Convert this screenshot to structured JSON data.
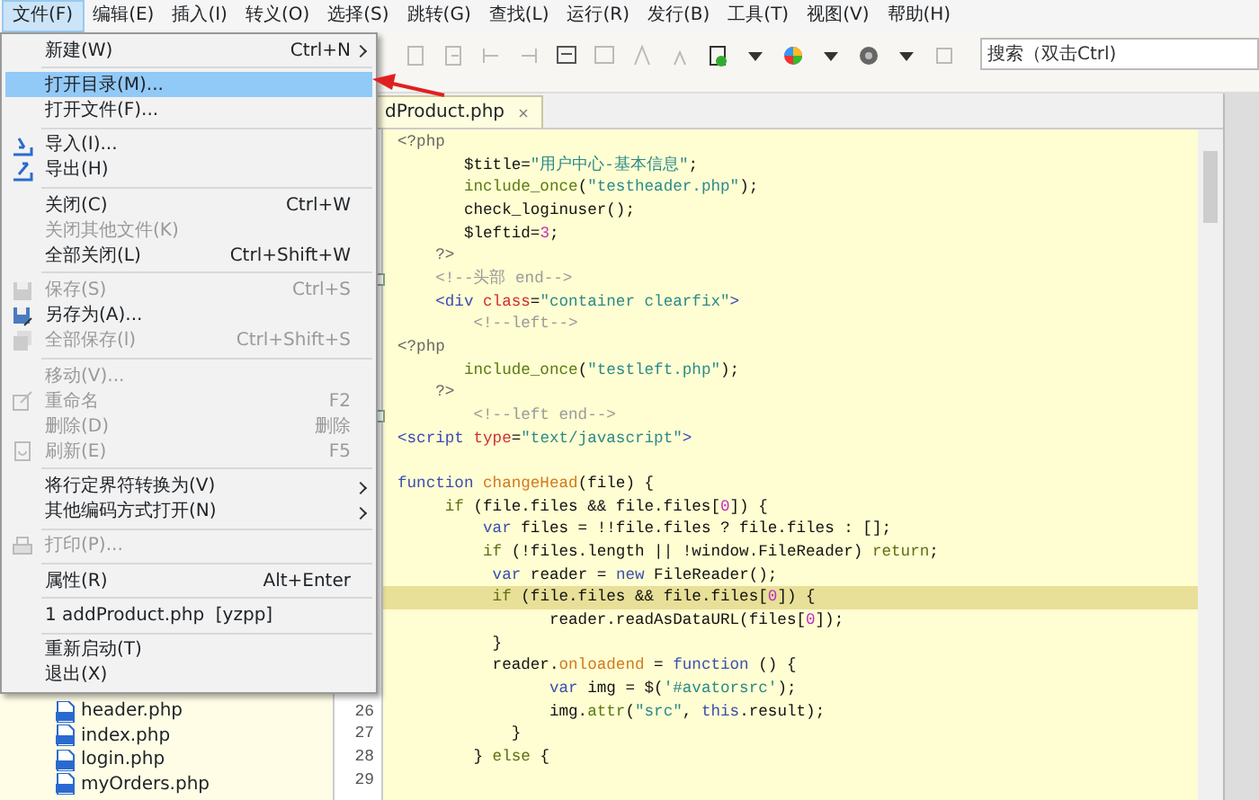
{
  "menubar": [
    {
      "label": "文件(F)",
      "selected": true
    },
    {
      "label": "编辑(E)",
      "selected": false
    },
    {
      "label": "插入(I)",
      "selected": false
    },
    {
      "label": "转义(O)",
      "selected": false
    },
    {
      "label": "选择(S)",
      "selected": false
    },
    {
      "label": "跳转(G)",
      "selected": false
    },
    {
      "label": "查找(L)",
      "selected": false
    },
    {
      "label": "运行(R)",
      "selected": false
    },
    {
      "label": "发行(B)",
      "selected": false
    },
    {
      "label": "工具(T)",
      "selected": false
    },
    {
      "label": "视图(V)",
      "selected": false
    },
    {
      "label": "帮助(H)",
      "selected": false
    }
  ],
  "search": {
    "placeholder": "搜索（双击Ctrl)"
  },
  "editor_tab": {
    "label": "dProduct.php"
  },
  "code_lines": [
    {
      "tokens": [
        {
          "kind": "php",
          "text": "<?php"
        }
      ]
    },
    {
      "tokens": [
        {
          "kind": "plain",
          "text": "       $title="
        },
        {
          "kind": "str",
          "text": "\"用户中心-基本信息\""
        },
        {
          "kind": "plain",
          "text": ";"
        }
      ]
    },
    {
      "tokens": [
        {
          "kind": "call",
          "text": "       include_once"
        },
        {
          "kind": "plain",
          "text": "("
        },
        {
          "kind": "str",
          "text": "\"testheader.php\""
        },
        {
          "kind": "plain",
          "text": ");"
        }
      ]
    },
    {
      "tokens": [
        {
          "kind": "plain",
          "text": "       check_loginuser();"
        }
      ]
    },
    {
      "tokens": [
        {
          "kind": "plain",
          "text": "       $leftid="
        },
        {
          "kind": "num",
          "text": "3"
        },
        {
          "kind": "plain",
          "text": ";"
        }
      ]
    },
    {
      "tokens": [
        {
          "kind": "php",
          "text": "    ?>"
        }
      ]
    },
    {
      "fold": true,
      "tokens": [
        {
          "kind": "cmt",
          "text": "    <!--头部 end-->"
        }
      ]
    },
    {
      "tokens": [
        {
          "kind": "tag",
          "text": "    <div"
        },
        {
          "kind": "attr",
          "text": " class"
        },
        {
          "kind": "plain",
          "text": "="
        },
        {
          "kind": "str",
          "text": "\"container clearfix\""
        },
        {
          "kind": "tag",
          "text": ">"
        }
      ]
    },
    {
      "tokens": [
        {
          "kind": "cmt",
          "text": "        <!--left-->"
        }
      ]
    },
    {
      "tokens": [
        {
          "kind": "php",
          "text": "<?php"
        }
      ]
    },
    {
      "tokens": [
        {
          "kind": "call",
          "text": "       include_once"
        },
        {
          "kind": "plain",
          "text": "("
        },
        {
          "kind": "str",
          "text": "\"testleft.php\""
        },
        {
          "kind": "plain",
          "text": ");"
        }
      ]
    },
    {
      "tokens": [
        {
          "kind": "php",
          "text": "    ?>"
        }
      ]
    },
    {
      "fold": true,
      "tokens": [
        {
          "kind": "cmt",
          "text": "        <!--left end-->"
        }
      ]
    },
    {
      "tokens": [
        {
          "kind": "tag",
          "text": "<script"
        },
        {
          "kind": "attr",
          "text": " type"
        },
        {
          "kind": "plain",
          "text": "="
        },
        {
          "kind": "str",
          "text": "\"text/javascript\""
        },
        {
          "kind": "tag",
          "text": ">"
        }
      ]
    },
    {
      "gap_before": true,
      "tokens": [
        {
          "kind": "kw",
          "text": "function"
        },
        {
          "kind": "fn",
          "text": " changeHead"
        },
        {
          "kind": "plain",
          "text": "(file) {"
        }
      ]
    },
    {
      "tokens": [
        {
          "kind": "ctrl",
          "text": "     if"
        },
        {
          "kind": "plain",
          "text": " (file.files && file.files["
        },
        {
          "kind": "num",
          "text": "0"
        },
        {
          "kind": "plain",
          "text": "]) {"
        }
      ]
    },
    {
      "tokens": [
        {
          "kind": "kw",
          "text": "         var"
        },
        {
          "kind": "plain",
          "text": " files = !!file.files ? file.files : [];"
        }
      ]
    },
    {
      "tokens": [
        {
          "kind": "ctrl",
          "text": "         if"
        },
        {
          "kind": "plain",
          "text": " (!files.length || !window.FileReader) "
        },
        {
          "kind": "ctrl",
          "text": "return"
        },
        {
          "kind": "plain",
          "text": ";"
        }
      ]
    },
    {
      "tokens": [
        {
          "kind": "kw",
          "text": "          var"
        },
        {
          "kind": "plain",
          "text": " reader = "
        },
        {
          "kind": "kw",
          "text": "new"
        },
        {
          "kind": "plain",
          "text": " FileReader();"
        }
      ]
    },
    {
      "current": true,
      "tokens": [
        {
          "kind": "ctrl",
          "text": "          if"
        },
        {
          "kind": "plain",
          "text": " (file.files && file.files["
        },
        {
          "kind": "num",
          "text": "0"
        },
        {
          "kind": "plain",
          "text": "]) {"
        }
      ]
    },
    {
      "tokens": [
        {
          "kind": "plain",
          "text": "                reader.readAsDataURL(files["
        },
        {
          "kind": "num",
          "text": "0"
        },
        {
          "kind": "plain",
          "text": "]);"
        }
      ]
    },
    {
      "tokens": [
        {
          "kind": "plain",
          "text": "          }"
        }
      ]
    },
    {
      "tokens": [
        {
          "kind": "plain",
          "text": "          reader."
        },
        {
          "kind": "fn",
          "text": "onloadend"
        },
        {
          "kind": "plain",
          "text": " = "
        },
        {
          "kind": "kw",
          "text": "function"
        },
        {
          "kind": "plain",
          "text": " () {"
        }
      ]
    },
    {
      "tokens": [
        {
          "kind": "kw",
          "text": "                var"
        },
        {
          "kind": "plain",
          "text": " img = $("
        },
        {
          "kind": "str",
          "text": "'#avatorsrc'"
        },
        {
          "kind": "plain",
          "text": ");"
        }
      ]
    },
    {
      "number": "26",
      "tokens": [
        {
          "kind": "plain",
          "text": "                img."
        },
        {
          "kind": "call",
          "text": "attr"
        },
        {
          "kind": "plain",
          "text": "("
        },
        {
          "kind": "str",
          "text": "\"src\""
        },
        {
          "kind": "plain",
          "text": ", "
        },
        {
          "kind": "kw",
          "text": "this"
        },
        {
          "kind": "plain",
          "text": ".result);"
        }
      ]
    },
    {
      "number": "27",
      "tokens": [
        {
          "kind": "plain",
          "text": "            }"
        }
      ]
    },
    {
      "number": "28",
      "tokens": [
        {
          "kind": "plain",
          "text": "        } "
        },
        {
          "kind": "ctrl",
          "text": "else"
        },
        {
          "kind": "plain",
          "text": " {"
        }
      ]
    },
    {
      "number": "29"
    }
  ],
  "file_tree": [
    {
      "label": "header.php"
    },
    {
      "label": "index.php"
    },
    {
      "label": "login.php"
    },
    {
      "label": "myOrders.php"
    }
  ],
  "file_menu": [
    {
      "kind": "item",
      "label": "新建(W)",
      "shortcut": "Ctrl+N",
      "submenu": true,
      "disabled": false,
      "selected": false
    },
    {
      "kind": "separator"
    },
    {
      "kind": "item",
      "label": "打开目录(M)...",
      "disabled": false,
      "selected": true
    },
    {
      "kind": "item",
      "label": "打开文件(F)...",
      "disabled": false,
      "selected": false
    },
    {
      "kind": "separator"
    },
    {
      "kind": "item",
      "label": "导入(I)...",
      "disabled": false,
      "selected": false
    },
    {
      "kind": "item",
      "label": "导出(H)",
      "disabled": false,
      "selected": false
    },
    {
      "kind": "separator"
    },
    {
      "kind": "item",
      "label": "关闭(C)",
      "shortcut": "Ctrl+W",
      "disabled": false,
      "selected": false
    },
    {
      "kind": "item",
      "label": "关闭其他文件(K)",
      "disabled": true,
      "selected": false
    },
    {
      "kind": "item",
      "label": "全部关闭(L)",
      "shortcut": "Ctrl+Shift+W",
      "disabled": false,
      "selected": false
    },
    {
      "kind": "separator"
    },
    {
      "kind": "item",
      "label": "保存(S)",
      "shortcut": "Ctrl+S",
      "disabled": true,
      "selected": false
    },
    {
      "kind": "item",
      "label": "另存为(A)...",
      "disabled": false,
      "selected": false
    },
    {
      "kind": "item",
      "label": "全部保存(l)",
      "shortcut": "Ctrl+Shift+S",
      "disabled": true,
      "selected": false
    },
    {
      "kind": "separator"
    },
    {
      "kind": "item",
      "label": "移动(V)...",
      "disabled": true,
      "selected": false
    },
    {
      "kind": "item",
      "label": "重命名",
      "shortcut": "F2",
      "disabled": true,
      "selected": false
    },
    {
      "kind": "item",
      "label": "删除(D)",
      "shortcut": "删除",
      "disabled": true,
      "selected": false
    },
    {
      "kind": "item",
      "label": "刷新(E)",
      "shortcut": "F5",
      "disabled": true,
      "selected": false
    },
    {
      "kind": "separator"
    },
    {
      "kind": "item",
      "label": "将行定界符转换为(V)",
      "submenu": true,
      "disabled": false,
      "selected": false
    },
    {
      "kind": "item",
      "label": "其他编码方式打开(N)",
      "submenu": true,
      "disabled": false,
      "selected": false
    },
    {
      "kind": "separator"
    },
    {
      "kind": "item",
      "label": "打印(P)...",
      "disabled": true,
      "selected": false
    },
    {
      "kind": "separator"
    },
    {
      "kind": "item",
      "label": "属性(R)",
      "shortcut": "Alt+Enter",
      "disabled": false,
      "selected": false
    },
    {
      "kind": "separator"
    },
    {
      "kind": "item",
      "label": "1 addProduct.php  [yzpp]",
      "disabled": false,
      "selected": false
    },
    {
      "kind": "separator"
    },
    {
      "kind": "item",
      "label": "重新启动(T)",
      "disabled": false,
      "selected": false
    },
    {
      "kind": "item",
      "label": "退出(X)",
      "disabled": false,
      "selected": false
    }
  ]
}
